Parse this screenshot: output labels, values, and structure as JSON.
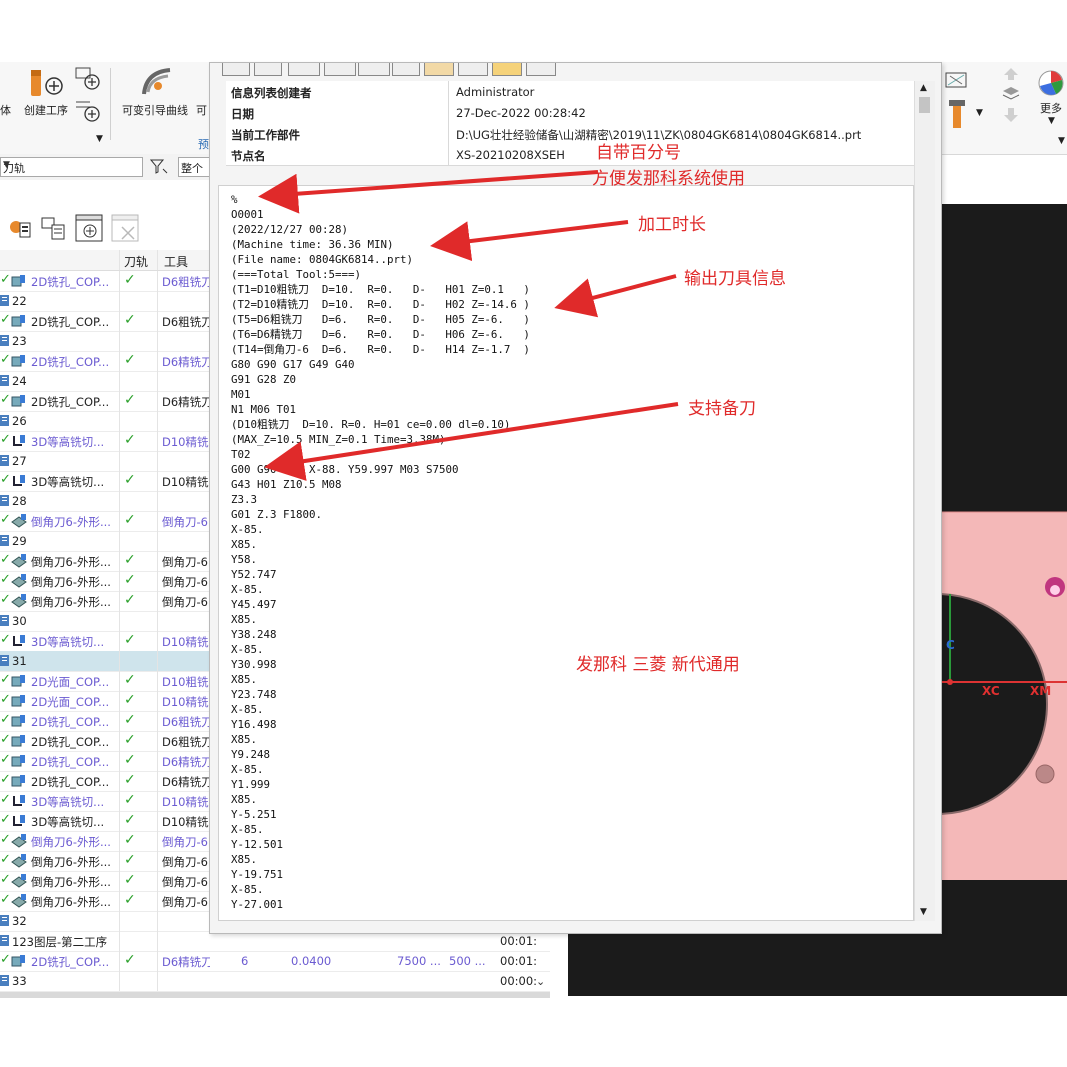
{
  "ribbon": {
    "labels": [
      "体",
      "创建工序",
      "可变引导曲线",
      "可"
    ],
    "groups": [
      "­",
      "预"
    ],
    "right_label": "更多"
  },
  "filter": {
    "select_value": "刀轨",
    "text_value": "整个"
  },
  "navigator": {
    "columns": [
      "刀轨",
      "工具"
    ],
    "rows": [
      {
        "kind": "op",
        "name": "2D铣孔_COP...",
        "tool": "D6粗铣刀",
        "purple": true
      },
      {
        "kind": "group",
        "name": "22"
      },
      {
        "kind": "op",
        "name": "2D铣孔_COP...",
        "tool": "D6粗铣刀",
        "purple": false
      },
      {
        "kind": "group",
        "name": "23"
      },
      {
        "kind": "op",
        "name": "2D铣孔_COP...",
        "tool": "D6精铣刀",
        "purple": true
      },
      {
        "kind": "group",
        "name": "24"
      },
      {
        "kind": "op",
        "name": "2D铣孔_COP...",
        "tool": "D6精铣刀",
        "purple": false
      },
      {
        "kind": "group",
        "name": "26"
      },
      {
        "kind": "op",
        "name": "3D等高铣切...",
        "tool": "D10精铣",
        "purple": true
      },
      {
        "kind": "group",
        "name": "27"
      },
      {
        "kind": "op",
        "name": "3D等高铣切...",
        "tool": "D10精铣",
        "purple": false
      },
      {
        "kind": "group",
        "name": "28"
      },
      {
        "kind": "op",
        "name": "倒角刀6-外形...",
        "tool": "倒角刀-6",
        "purple": true
      },
      {
        "kind": "group",
        "name": "29"
      },
      {
        "kind": "op",
        "name": "倒角刀6-外形...",
        "tool": "倒角刀-6",
        "purple": false
      },
      {
        "kind": "op",
        "name": "倒角刀6-外形...",
        "tool": "倒角刀-6",
        "purple": false
      },
      {
        "kind": "op",
        "name": "倒角刀6-外形...",
        "tool": "倒角刀-6",
        "purple": false
      },
      {
        "kind": "group",
        "name": "30"
      },
      {
        "kind": "op",
        "name": "3D等高铣切...",
        "tool": "D10精铣",
        "purple": true
      },
      {
        "kind": "group",
        "name": "31",
        "selected": true
      },
      {
        "kind": "op",
        "name": "2D光面_COP...",
        "tool": "D10粗铣",
        "purple": true
      },
      {
        "kind": "op",
        "name": "2D光面_COP...",
        "tool": "D10精铣",
        "purple": true
      },
      {
        "kind": "op",
        "name": "2D铣孔_COP...",
        "tool": "D6粗铣刀",
        "purple": true
      },
      {
        "kind": "op",
        "name": "2D铣孔_COP...",
        "tool": "D6粗铣刀",
        "purple": false
      },
      {
        "kind": "op",
        "name": "2D铣孔_COP...",
        "tool": "D6精铣刀",
        "purple": true
      },
      {
        "kind": "op",
        "name": "2D铣孔_COP...",
        "tool": "D6精铣刀",
        "purple": false
      },
      {
        "kind": "op",
        "name": "3D等高铣切...",
        "tool": "D10精铣",
        "purple": true
      },
      {
        "kind": "op",
        "name": "3D等高铣切...",
        "tool": "D10精铣",
        "purple": false
      },
      {
        "kind": "op",
        "name": "倒角刀6-外形...",
        "tool": "倒角刀-6",
        "purple": true
      },
      {
        "kind": "op",
        "name": "倒角刀6-外形...",
        "tool": "倒角刀-6",
        "purple": false
      },
      {
        "kind": "op",
        "name": "倒角刀6-外形...",
        "tool": "倒角刀-6",
        "purple": false
      },
      {
        "kind": "op",
        "name": "倒角刀6-外形...",
        "tool": "倒角刀-6",
        "purple": false
      },
      {
        "kind": "group",
        "name": "32"
      },
      {
        "kind": "group",
        "name": "123图层-第二工序",
        "time": "00:01:"
      },
      {
        "kind": "op",
        "name": "2D铣孔_COP...",
        "tool": "D6精铣刀",
        "purple": true,
        "extra": [
          "6",
          "0.0400",
          "7500 ...",
          "500 ...",
          "00:01:"
        ]
      },
      {
        "kind": "group",
        "name": "33",
        "time": "00:00:"
      }
    ]
  },
  "info": {
    "table": [
      {
        "key": "信息列表创建者",
        "value": "Administrator"
      },
      {
        "key": "日期",
        "value": "27-Dec-2022 00:28:42"
      },
      {
        "key": "当前工作部件",
        "value": "D:\\UG壮壮经验储备\\山湖精密\\2019\\11\\ZK\\0804GK6814\\0804GK6814..prt"
      },
      {
        "key": "节点名",
        "value": "XS-20210208XSEH"
      }
    ],
    "code_lines": [
      "%",
      "O0001",
      "(2022/12/27 00:28)",
      "(Machine time: 36.36 MIN)",
      "(File name: 0804GK6814..prt)",
      "(===Total Tool:5===)",
      "(T1=D10粗铣刀  D=10.  R=0.   D-   H01 Z=0.1   )",
      "(T2=D10精铣刀  D=10.  R=0.   D-   H02 Z=-14.6 )",
      "(T5=D6粗铣刀   D=6.   R=0.   D-   H05 Z=-6.   )",
      "(T6=D6精铣刀   D=6.   R=0.   D-   H06 Z=-6.   )",
      "(T14=倒角刀-6  D=6.   R=0.   D-   H14 Z=-1.7  )",
      "G80 G90 G17 G49 G40",
      "G91 G28 Z0",
      "M01",
      "N1 M06 T01",
      "(D10粗铣刀  D=10. R=0. H=01 ce=0.00 dl=0.10)",
      "(MAX_Z=10.5 MIN_Z=0.1 Time=3.38M)",
      "T02",
      "G00 G90 G54 X-88. Y59.997 M03 S7500",
      "G43 H01 Z10.5 M08",
      "Z3.3",
      "G01 Z.3 F1800.",
      "X-85.",
      "X85.",
      "Y58.",
      "Y52.747",
      "X-85.",
      "Y45.497",
      "X85.",
      "Y38.248",
      "X-85.",
      "Y30.998",
      "X85.",
      "Y23.748",
      "X-85.",
      "Y16.498",
      "X85.",
      "Y9.248",
      "X-85.",
      "Y1.999",
      "X85.",
      "Y-5.251",
      "X-85.",
      "Y-12.501",
      "X85.",
      "Y-19.751",
      "X-85.",
      "Y-27.001"
    ]
  },
  "annotations": {
    "percent_1": "自带百分号",
    "percent_2": "方便发那科系统使用",
    "machine_time": "加工时长",
    "tool_info": "输出刀具信息",
    "spare_tool": "支持备刀",
    "controllers": "发那科 三菱 新代通用"
  },
  "graphics": {
    "axis_xc": "XC",
    "axis_xm": "XM",
    "axis_yc": "C"
  },
  "colors": {
    "annotation": "#e02a2a",
    "check": "#2aa02a",
    "op_purple": "#6b5bd1",
    "part_pink": "#f4b8b8",
    "viewport": "#1b1b1b"
  }
}
